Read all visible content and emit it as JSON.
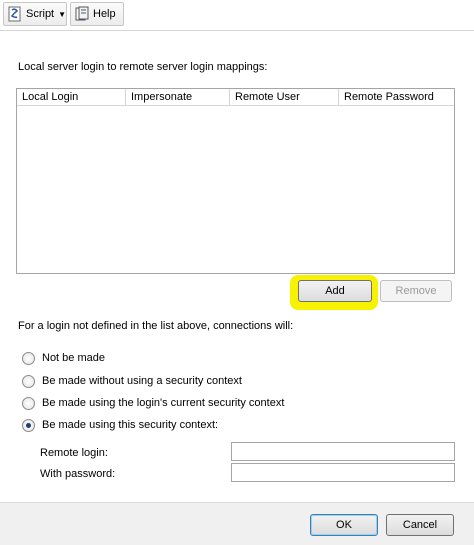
{
  "toolbar": {
    "script_label": "Script",
    "help_label": "Help"
  },
  "mappings": {
    "section_label": "Local server login to remote server login mappings:",
    "columns": [
      "Local Login",
      "Impersonate",
      "Remote User",
      "Remote Password"
    ],
    "add_label": "Add",
    "remove_label": "Remove"
  },
  "connections": {
    "section_label": "For a login not defined in the list above, connections will:",
    "options": [
      {
        "label": "Not be made",
        "checked": false
      },
      {
        "label": "Be made without using a security context",
        "checked": false
      },
      {
        "label": "Be made using the login's current security context",
        "checked": false
      },
      {
        "label": "Be made using this security context:",
        "checked": true
      }
    ],
    "remote_login_label": "Remote login:",
    "remote_login_value": "",
    "password_label": "With password:",
    "password_value": ""
  },
  "footer": {
    "ok_label": "OK",
    "cancel_label": "Cancel"
  },
  "colors": {
    "highlight": "#f7f300",
    "default_button_border": "#3c7fb1"
  }
}
